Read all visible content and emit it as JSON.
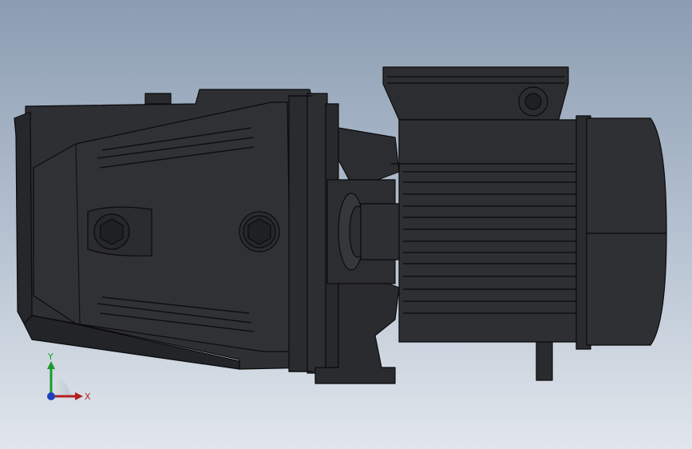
{
  "viewport": {
    "background_top": "#8c9db2",
    "background_bottom": "#e1e6ec"
  },
  "model": {
    "name_hint": "pump-motor-assembly",
    "body_color": "#2a2b2e",
    "edge_color": "#0b0b0c"
  },
  "triad": {
    "x_label": "X",
    "y_label": "Y",
    "x_color": "#b32020",
    "y_color": "#1a9a2a",
    "z_color": "#1f3fbf"
  }
}
